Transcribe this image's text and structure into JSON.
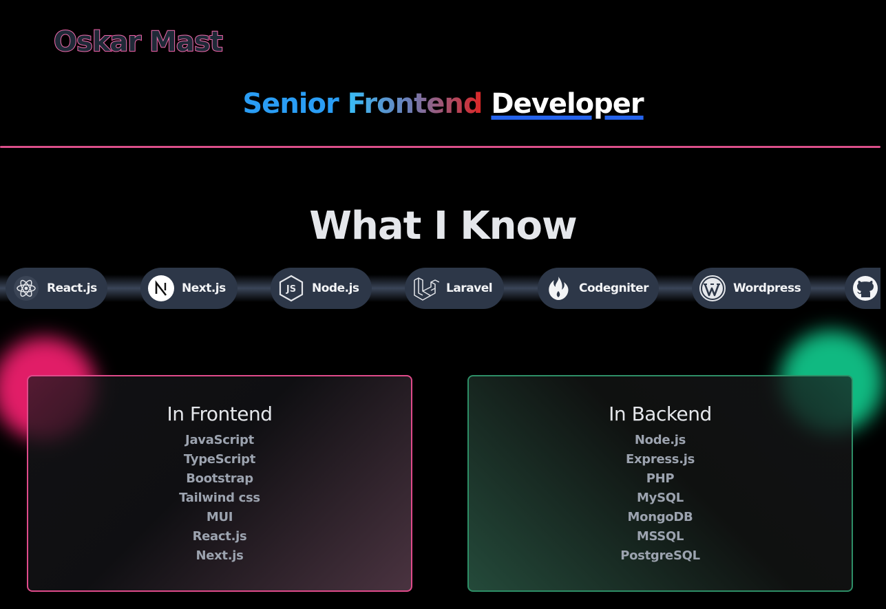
{
  "header": {
    "logo": "Oskar Mast",
    "tagline": {
      "word1": "Senior",
      "word2": "Frontend",
      "word3": "Developer"
    }
  },
  "skills_section": {
    "title": "What I Know",
    "tech": [
      {
        "label": "React.js",
        "icon": "react-icon"
      },
      {
        "label": "Next.js",
        "icon": "nextjs-icon"
      },
      {
        "label": "Node.js",
        "icon": "nodejs-icon"
      },
      {
        "label": "Laravel",
        "icon": "laravel-icon"
      },
      {
        "label": "Codegniter",
        "icon": "codeigniter-icon"
      },
      {
        "label": "Wordpress",
        "icon": "wordpress-icon"
      },
      {
        "label": "",
        "icon": "github-icon"
      }
    ]
  },
  "frontend": {
    "title": "In Frontend",
    "items": [
      "JavaScript",
      "TypeScript",
      "Bootstrap",
      "Tailwind css",
      "MUI",
      "React.js",
      "Next.js"
    ]
  },
  "backend": {
    "title": "In Backend",
    "items": [
      "Node.js",
      "Express.js",
      "PHP",
      "MySQL",
      "MongoDB",
      "MSSQL",
      "PostgreSQL"
    ]
  },
  "colors": {
    "accent_pink": "#e04b8b",
    "accent_green": "#2e8f67",
    "accent_blue": "#2563eb"
  }
}
